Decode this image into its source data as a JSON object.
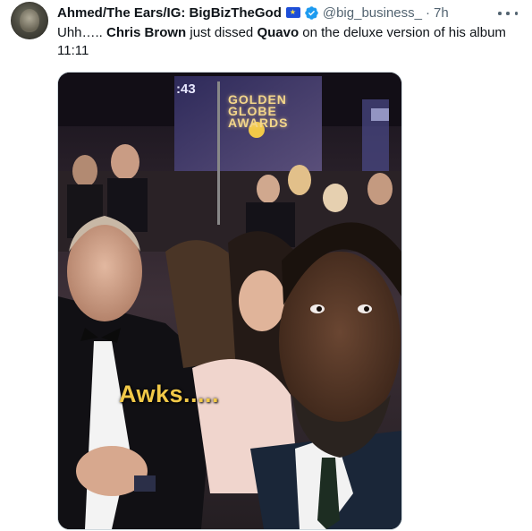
{
  "tweet": {
    "display_name": "Ahmed/The Ears/IG: BigBizTheGod",
    "handle": "@big_business_",
    "separator": "·",
    "time": "7h",
    "text_parts": {
      "p1": "Uhh….. ",
      "b1": "Chris Brown",
      "p2": " just dissed ",
      "b2": "Quavo",
      "p3": " on the deluxe version of his album 11:11"
    },
    "icons": {
      "flag": "flag-icon",
      "verified": "verified-badge-icon",
      "more": "more-options-icon"
    }
  },
  "media": {
    "screen_number": ":43",
    "screen_title_lines": [
      "GOLDEN",
      "GLOBE",
      "AWARDS"
    ],
    "caption": "Awks....."
  },
  "colors": {
    "verified_blue": "#1d9bf0",
    "secondary_text": "#536471",
    "caption_yellow": "#f2c948"
  }
}
